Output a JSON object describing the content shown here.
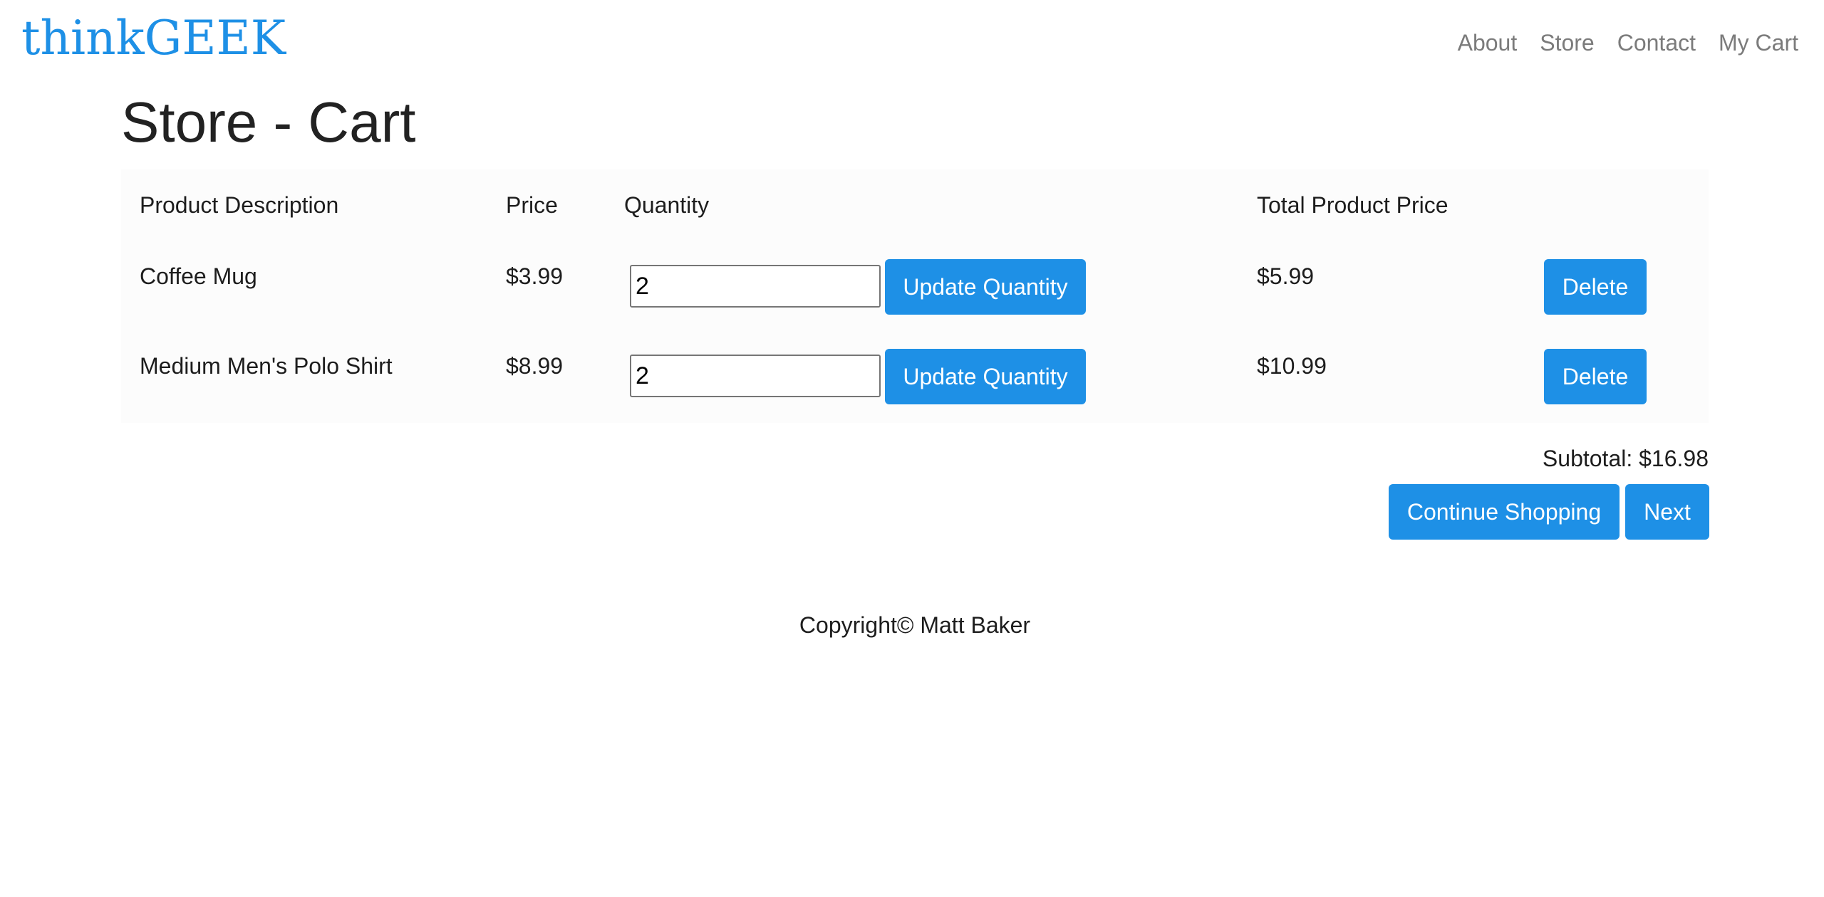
{
  "brand": {
    "name": "thinkGEEK"
  },
  "nav": {
    "items": [
      {
        "label": "About"
      },
      {
        "label": "Store"
      },
      {
        "label": "Contact"
      },
      {
        "label": "My Cart"
      }
    ]
  },
  "page": {
    "title": "Store - Cart"
  },
  "cart": {
    "headers": {
      "description": "Product Description",
      "price": "Price",
      "quantity": "Quantity",
      "total": "Total Product Price"
    },
    "items": [
      {
        "description": "Coffee Mug",
        "price": "$3.99",
        "quantity": "2",
        "update_label": "Update Quantity",
        "total": "$5.99",
        "delete_label": "Delete"
      },
      {
        "description": "Medium Men's Polo Shirt",
        "price": "$8.99",
        "quantity": "2",
        "update_label": "Update Quantity",
        "total": "$10.99",
        "delete_label": "Delete"
      }
    ]
  },
  "summary": {
    "subtotal": "Subtotal: $16.98",
    "continue_label": "Continue Shopping",
    "next_label": "Next"
  },
  "footer": {
    "copyright": "Copyright© Matt Baker"
  },
  "colors": {
    "accent": "#1e90e6",
    "nav_text": "#7b7b7b",
    "table_bg": "#fcfcfc"
  }
}
